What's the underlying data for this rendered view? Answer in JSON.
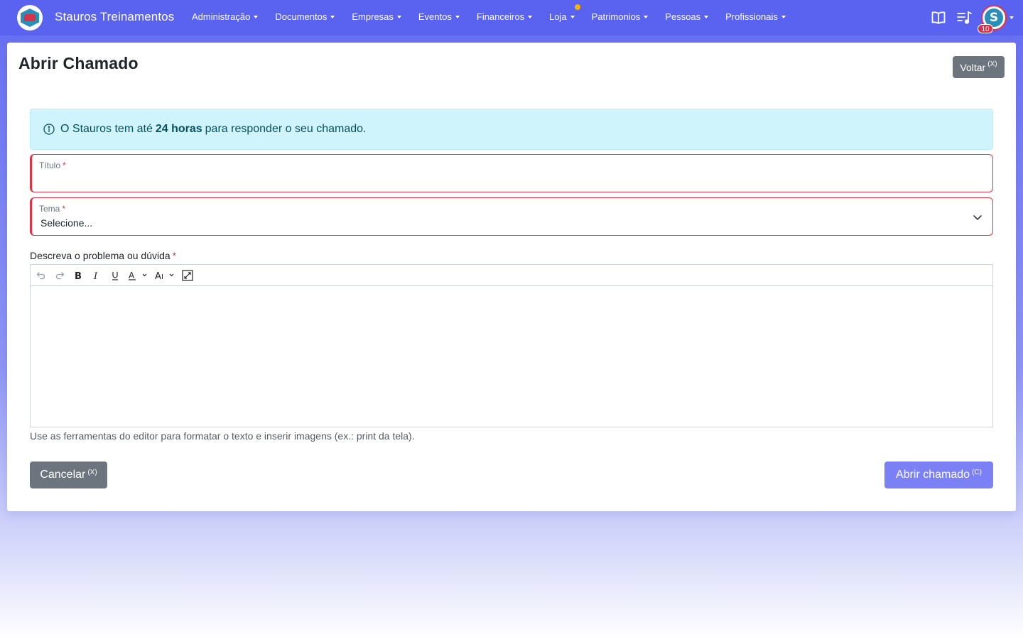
{
  "navbar": {
    "brand": "Stauros Treinamentos",
    "menu": [
      {
        "label": "Administração"
      },
      {
        "label": "Documentos"
      },
      {
        "label": "Empresas"
      },
      {
        "label": "Eventos"
      },
      {
        "label": "Financeiros"
      },
      {
        "label": "Loja"
      },
      {
        "label": "Patrimonios"
      },
      {
        "label": "Pessoas"
      },
      {
        "label": "Profissionais"
      }
    ],
    "icons": [
      "book-icon",
      "music-list-icon",
      "avatar"
    ],
    "avatar_letter": "S",
    "notification_count": "10",
    "color": "#5a63f0"
  },
  "page": {
    "title": "Abrir Chamado",
    "back_label": "Voltar",
    "back_shortcut": "(X)"
  },
  "alert": {
    "prefix": "O Stauros tem até",
    "highlight": "24 horas",
    "suffix": "para responder o seu chamado."
  },
  "form": {
    "titulo_label": "Título",
    "titulo_value": "",
    "tema_label": "Tema",
    "tema_value": "Selecione...",
    "required_mark": "*",
    "descricao_label": "Descreva o problema ou dúvida",
    "toolbar_items": [
      "undo",
      "redo",
      "bold",
      "italic",
      "underline",
      "font-color",
      "font-size",
      "fullscreen"
    ],
    "help_text": "Use as ferramentas do editor para formatar o texto e inserir imagens (ex.: print da tela)."
  },
  "actions": {
    "cancel_label": "Cancelar",
    "cancel_shortcut": "(X)",
    "submit_label": "Abrir chamado",
    "submit_shortcut": "(C)"
  }
}
